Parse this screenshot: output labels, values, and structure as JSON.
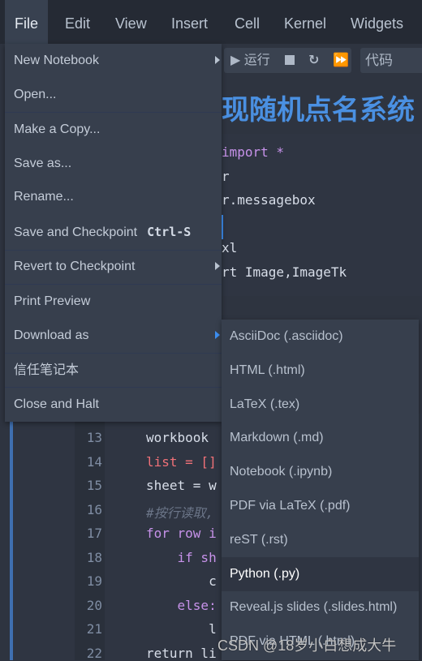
{
  "menubar": {
    "items": [
      "File",
      "Edit",
      "View",
      "Insert",
      "Cell",
      "Kernel",
      "Widgets"
    ],
    "active": "File"
  },
  "toolbar": {
    "run_label": "运行",
    "cell_type": "代码"
  },
  "heading": "现随机点名系统",
  "code_top": [
    "import *",
    "r",
    "r.messagebox",
    "",
    "xl",
    "rt Image,ImageTk"
  ],
  "code_bottom": [
    {
      "n": "13",
      "t": "workbook"
    },
    {
      "n": "14",
      "t": "list = []"
    },
    {
      "n": "15",
      "t": "sheet = w"
    },
    {
      "n": "16",
      "t": "#按行读取,"
    },
    {
      "n": "17",
      "t": "for row i"
    },
    {
      "n": "18",
      "t": "    if sh"
    },
    {
      "n": "19",
      "t": "        c"
    },
    {
      "n": "20",
      "t": "    else:"
    },
    {
      "n": "21",
      "t": "        l"
    },
    {
      "n": "22",
      "t": "return li"
    }
  ],
  "file_menu": [
    {
      "label": "New Notebook",
      "submenu": true
    },
    {
      "label": "Open..."
    },
    {
      "label": "Make a Copy..."
    },
    {
      "label": "Save as..."
    },
    {
      "label": "Rename..."
    },
    {
      "label": "Save and Checkpoint",
      "shortcut": "Ctrl-S"
    },
    {
      "label": "Revert to Checkpoint",
      "submenu": true
    },
    {
      "label": "Print Preview"
    },
    {
      "label": "Download as",
      "submenu": true
    },
    {
      "label": "信任笔记本"
    },
    {
      "label": "Close and Halt"
    }
  ],
  "download_submenu": [
    "AsciiDoc (.asciidoc)",
    "HTML (.html)",
    "LaTeX (.tex)",
    "Markdown (.md)",
    "Notebook (.ipynb)",
    "PDF via LaTeX (.pdf)",
    "reST (.rst)",
    "Python (.py)",
    "Reveal.js slides (.slides.html)",
    "PDF via HTML (.html)"
  ],
  "highlighted_item": "Python (.py)",
  "watermark": "CSDN @18岁小白想成大牛",
  "colors": {
    "accent": "#3d8ef0",
    "heading": "#4a90e2",
    "menu_bg": "#373f4d",
    "menubar_bg": "#252a34"
  }
}
